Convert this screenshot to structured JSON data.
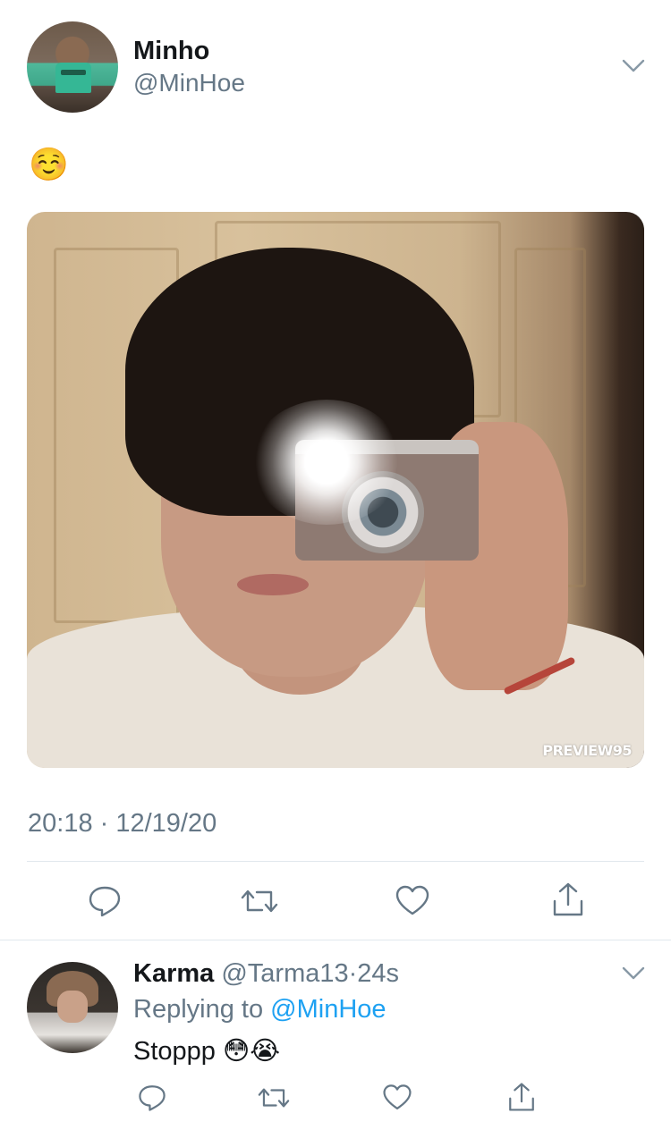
{
  "tweet": {
    "author_name": "Minho",
    "author_handle": "@MinHoe",
    "text": "☺️",
    "image_watermark": "PREVIEW95",
    "timestamp": "20:18 · 12/19/20",
    "actions": [
      "reply-icon",
      "retweet-icon",
      "like-icon",
      "share-icon"
    ]
  },
  "reply": {
    "author_name": "Karma",
    "author_handle": "@Tarma13",
    "separator": "·",
    "time": "24s",
    "replying_label": "Replying to",
    "replying_to_handle": "@MinHoe",
    "text": "Stoppp 😳😭",
    "actions": [
      "reply-icon",
      "retweet-icon",
      "like-icon",
      "share-icon"
    ]
  },
  "colors": {
    "text_primary": "#14171a",
    "text_secondary": "#657786",
    "link": "#1da1f2",
    "divider": "#e1e8ed",
    "icon": "#657786"
  }
}
